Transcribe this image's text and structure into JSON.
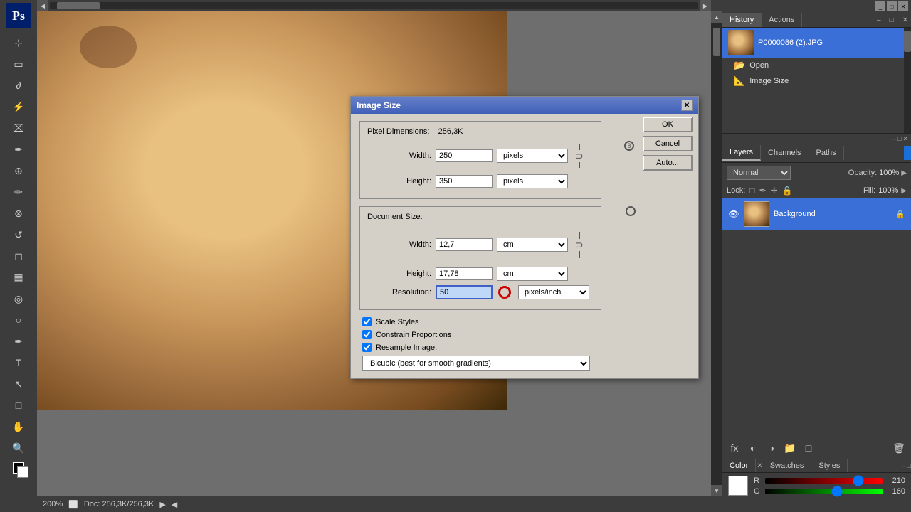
{
  "app": {
    "name": "Photoshop",
    "logo": "Ps"
  },
  "canvas": {
    "zoom": "200%",
    "doc_info": "Doc: 256,3K/256,3K"
  },
  "history_panel": {
    "tabs": [
      {
        "label": "History",
        "active": true
      },
      {
        "label": "Actions",
        "active": false
      }
    ],
    "items": [
      {
        "label": "P0000086 (2).JPG",
        "type": "snapshot"
      },
      {
        "label": "Open",
        "type": "action"
      },
      {
        "label": "Image Size",
        "type": "action"
      }
    ]
  },
  "layers_panel": {
    "tabs": [
      {
        "label": "Layers",
        "active": true
      },
      {
        "label": "Channels",
        "active": false
      },
      {
        "label": "Paths",
        "active": false
      }
    ],
    "blend_mode": "Normal",
    "opacity_label": "Opacity:",
    "opacity_value": "100%",
    "lock_label": "Lock:",
    "fill_label": "Fill:",
    "fill_value": "100%",
    "layers": [
      {
        "name": "Background",
        "visible": true,
        "locked": true
      }
    ]
  },
  "color_panel": {
    "tabs": [
      {
        "label": "Color",
        "active": true
      },
      {
        "label": "Swatches",
        "active": false
      },
      {
        "label": "Styles",
        "active": false
      }
    ],
    "r_label": "R",
    "g_label": "G",
    "r_value": "210",
    "g_value": "160",
    "swatch_color": "#ffffff"
  },
  "dialog": {
    "title": "Image Size",
    "pixel_dimensions": {
      "label": "Pixel Dimensions:",
      "size": "256,3K",
      "width_label": "Width:",
      "width_value": "250",
      "width_unit": "pixels",
      "height_label": "Height:",
      "height_value": "350",
      "height_unit": "pixels"
    },
    "document_size": {
      "label": "Document Size:",
      "width_label": "Width:",
      "width_value": "12,7",
      "width_unit": "cm",
      "height_label": "Height:",
      "height_value": "17,78",
      "height_unit": "cm",
      "resolution_label": "Resolution:",
      "resolution_value": "50",
      "resolution_unit": "pixels/inch"
    },
    "checkboxes": [
      {
        "label": "Scale Styles",
        "checked": true
      },
      {
        "label": "Constrain Proportions",
        "checked": true
      },
      {
        "label": "Resample Image:",
        "checked": true
      }
    ],
    "resample_method": "Bicubic (best for smooth gradients)",
    "buttons": {
      "ok": "OK",
      "cancel": "Cancel",
      "auto": "Auto..."
    }
  }
}
